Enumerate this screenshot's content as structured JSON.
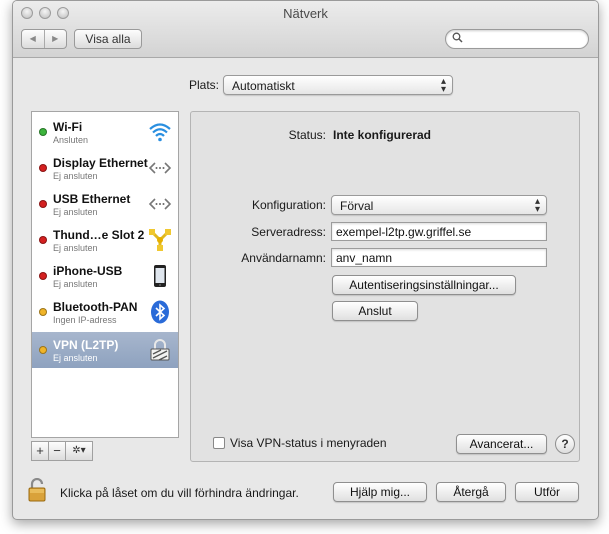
{
  "window": {
    "title": "Nätverk"
  },
  "toolbar": {
    "back": "◀",
    "forward": "▶",
    "show_all": "Visa alla",
    "search_placeholder": ""
  },
  "location": {
    "label": "Plats:",
    "value": "Automatiskt"
  },
  "services": [
    {
      "name": "Wi-Fi",
      "status": "Ansluten",
      "dot": "#3cb43c",
      "icon": "wifi-icon"
    },
    {
      "name": "Display Ethernet",
      "status": "Ej ansluten",
      "dot": "#d42020",
      "icon": "ethernet-icon"
    },
    {
      "name": "USB Ethernet",
      "status": "Ej ansluten",
      "dot": "#d42020",
      "icon": "ethernet-icon"
    },
    {
      "name": "Thund…e Slot 2",
      "status": "Ej ansluten",
      "dot": "#d42020",
      "icon": "thunderbolt-icon"
    },
    {
      "name": "iPhone-USB",
      "status": "Ej ansluten",
      "dot": "#d42020",
      "icon": "iphone-icon"
    },
    {
      "name": "Bluetooth-PAN",
      "status": "Ingen IP-adress",
      "dot": "#f0b428",
      "icon": "bluetooth-icon"
    },
    {
      "name": "VPN (L2TP)",
      "status": "Ej ansluten",
      "dot": "#f0b428",
      "icon": "vpn-lock-icon",
      "selected": true
    }
  ],
  "sidebar_buttons": {
    "add": "+",
    "remove": "−",
    "action": "✲▾"
  },
  "detail": {
    "status_label": "Status:",
    "status_value": "Inte konfigurerad",
    "config_label": "Konfiguration:",
    "config_value": "Förval",
    "server_label": "Serveradress:",
    "server_value": "exempel-l2tp.gw.griffel.se",
    "account_label": "Användarnamn:",
    "account_value": "anv_namn",
    "auth_button": "Autentiseringsinställningar...",
    "connect_button": "Anslut",
    "show_vpn_label": "Visa VPN-status i menyraden",
    "advanced_button": "Avancerat...",
    "help": "?"
  },
  "footer": {
    "lock_text": "Klicka på låset om du vill förhindra ändringar.",
    "assist_button": "Hjälp mig...",
    "revert_button": "Återgå",
    "apply_button": "Utför"
  },
  "colors": {
    "selection": "#9aabc6",
    "connected": "#3cb43c",
    "disconnected": "#d42020",
    "partial": "#f0b428"
  }
}
